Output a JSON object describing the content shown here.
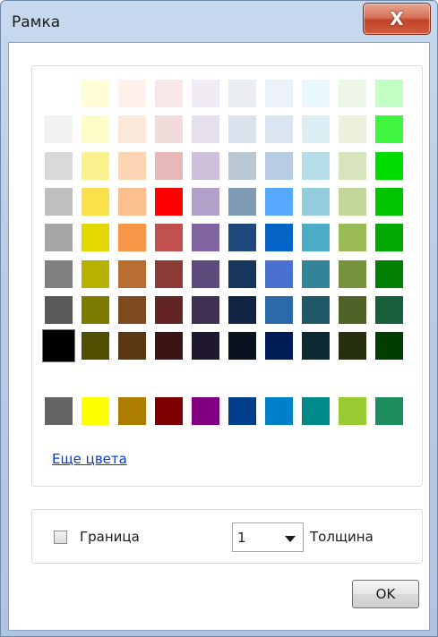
{
  "window": {
    "title": "Рамка",
    "close_glyph": "X"
  },
  "palette": {
    "rows": [
      [
        "#ffffff",
        "#fffed6",
        "#fff2ec",
        "#f9e8ea",
        "#f1ecf4",
        "#eaeef3",
        "#edf2f9",
        "#e9f7ff",
        "#eef6e8",
        "#c2ffc2"
      ],
      [
        "#f2f2f2",
        "#fefdc7",
        "#fde9d9",
        "#f2dcdb",
        "#e5e0ec",
        "#dbe4ee",
        "#dbe5f1",
        "#dbeef4",
        "#ebf1dd",
        "#40f540"
      ],
      [
        "#d9d9d9",
        "#fbf28f",
        "#fcd5b4",
        "#e6b8b7",
        "#ccc0da",
        "#b8c9d4",
        "#b8cce4",
        "#b7dde8",
        "#d7e4bd",
        "#00dd00"
      ],
      [
        "#bfbfbf",
        "#fbe04b",
        "#fabf8f",
        "#ff0000",
        "#b2a1c7",
        "#7f9ab5",
        "#56a9ff",
        "#93cddd",
        "#c4d79b",
        "#00c400"
      ],
      [
        "#a6a6a6",
        "#e0d800",
        "#f79646",
        "#c0504d",
        "#8064a2",
        "#1f497d",
        "#0463c7",
        "#4bacc6",
        "#9bbb59",
        "#00a800"
      ],
      [
        "#808080",
        "#b7b100",
        "#b86e31",
        "#8b3a36",
        "#5f4a7c",
        "#16365c",
        "#4a70d0",
        "#318499",
        "#76923c",
        "#007f00"
      ],
      [
        "#595959",
        "#7d7a00",
        "#7e4a1f",
        "#632523",
        "#3f3151",
        "#102544",
        "#2a6aa8",
        "#215868",
        "#4f6228",
        "#175e3b"
      ],
      [
        "#000000",
        "#504e00",
        "#5a3814",
        "#3b1414",
        "#20182e",
        "#0a121f",
        "#001c55",
        "#0b2a33",
        "#26300f",
        "#003d00"
      ]
    ],
    "standard": [
      "#636363",
      "#ffff00",
      "#ad7d00",
      "#7f0000",
      "#800080",
      "#003e8d",
      "#0080c6",
      "#008b8b",
      "#99cc33",
      "#1f8e5f"
    ],
    "selected_color": "#000000",
    "more_colors_label": "Еще цвета"
  },
  "options": {
    "border_label": "Граница",
    "border_checked": false,
    "thickness_value": "1",
    "thickness_label": "Толщина"
  },
  "buttons": {
    "ok_label": "OK"
  }
}
